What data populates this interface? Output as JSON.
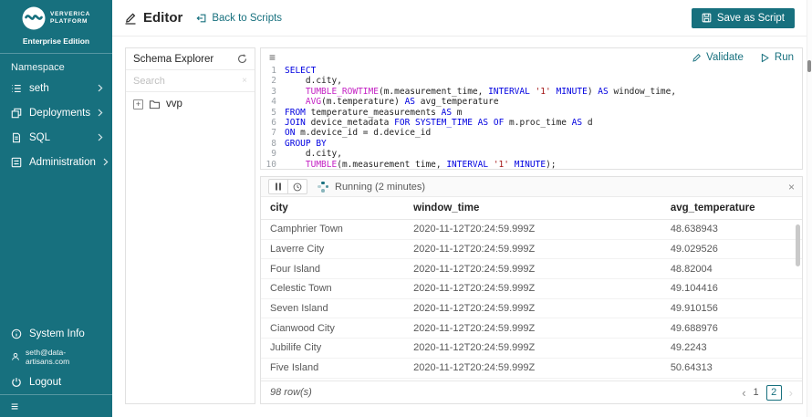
{
  "colors": {
    "accent": "#17707e",
    "sql_keyword": "#0000e0",
    "sql_function": "#c31fc3",
    "sql_string": "#a31515",
    "sql_plain": "#1f1f1f"
  },
  "sidebar": {
    "brand_line1": "VERVERICA",
    "brand_line2": "PLATFORM",
    "edition": "Enterprise Edition",
    "namespace_label": "Namespace",
    "namespace_item": "seth",
    "nav_items": [
      {
        "label": "Deployments",
        "icon": "deployments-icon"
      },
      {
        "label": "SQL",
        "icon": "sql-document-icon"
      },
      {
        "label": "Administration",
        "icon": "administration-icon"
      }
    ],
    "system_info_label": "System Info",
    "user_email": "seth@data-artisans.com",
    "logout_label": "Logout"
  },
  "header": {
    "page_title": "Editor",
    "back_link_label": "Back to Scripts",
    "save_button_label": "Save as Script"
  },
  "schema_explorer": {
    "title": "Schema Explorer",
    "search_placeholder": "Search",
    "tree_items": [
      {
        "label": "vvp",
        "icon": "folder-icon",
        "expandable": true
      }
    ]
  },
  "editor": {
    "validate_label": "Validate",
    "run_label": "Run",
    "code_lines": [
      {
        "num": "1",
        "segments": [
          [
            "SELECT",
            "k"
          ]
        ]
      },
      {
        "num": "2",
        "segments": [
          [
            "    d.city,",
            "p"
          ]
        ]
      },
      {
        "num": "3",
        "segments": [
          [
            "    ",
            "p"
          ],
          [
            "TUMBLE_ROWTIME",
            "f"
          ],
          [
            "(m.measurement_time, ",
            "p"
          ],
          [
            "INTERVAL",
            "k"
          ],
          [
            " ",
            "p"
          ],
          [
            "'1'",
            "s"
          ],
          [
            " ",
            "p"
          ],
          [
            "MINUTE",
            "k"
          ],
          [
            ") ",
            "p"
          ],
          [
            "AS",
            "k"
          ],
          [
            " window_time,",
            "p"
          ]
        ]
      },
      {
        "num": "4",
        "segments": [
          [
            "    ",
            "p"
          ],
          [
            "AVG",
            "f"
          ],
          [
            "(m.temperature) ",
            "p"
          ],
          [
            "AS",
            "k"
          ],
          [
            " avg_temperature",
            "p"
          ]
        ]
      },
      {
        "num": "5",
        "segments": [
          [
            "FROM",
            "k"
          ],
          [
            " temperature_measurements ",
            "p"
          ],
          [
            "AS",
            "k"
          ],
          [
            " m",
            "p"
          ]
        ]
      },
      {
        "num": "6",
        "segments": [
          [
            "JOIN",
            "k"
          ],
          [
            " device_metadata ",
            "p"
          ],
          [
            "FOR SYSTEM_TIME",
            "k"
          ],
          [
            " ",
            "p"
          ],
          [
            "AS",
            "k"
          ],
          [
            " ",
            "p"
          ],
          [
            "OF",
            "k"
          ],
          [
            " m.proc_time ",
            "p"
          ],
          [
            "AS",
            "k"
          ],
          [
            " d",
            "p"
          ]
        ]
      },
      {
        "num": "7",
        "segments": [
          [
            "ON",
            "k"
          ],
          [
            " m.device_id = d.device_id",
            "p"
          ]
        ]
      },
      {
        "num": "8",
        "segments": [
          [
            "GROUP BY",
            "k"
          ]
        ]
      },
      {
        "num": "9",
        "segments": [
          [
            "    d.city,",
            "p"
          ]
        ]
      },
      {
        "num": "10",
        "segments": [
          [
            "    ",
            "p"
          ],
          [
            "TUMBLE",
            "f"
          ],
          [
            "(m.measurement_time, ",
            "p"
          ],
          [
            "INTERVAL",
            "k"
          ],
          [
            " ",
            "p"
          ],
          [
            "'1'",
            "s"
          ],
          [
            " ",
            "p"
          ],
          [
            "MINUTE",
            "k"
          ],
          [
            ");",
            "p"
          ]
        ]
      }
    ]
  },
  "results": {
    "status_text": "Running (2 minutes)",
    "columns": [
      "city",
      "window_time",
      "avg_temperature"
    ],
    "rows": [
      [
        "Camphrier Town",
        "2020-11-12T20:24:59.999Z",
        "48.638943"
      ],
      [
        "Laverre City",
        "2020-11-12T20:24:59.999Z",
        "49.029526"
      ],
      [
        "Four Island",
        "2020-11-12T20:24:59.999Z",
        "48.82004"
      ],
      [
        "Celestic Town",
        "2020-11-12T20:24:59.999Z",
        "49.104416"
      ],
      [
        "Seven Island",
        "2020-11-12T20:24:59.999Z",
        "49.910156"
      ],
      [
        "Cianwood City",
        "2020-11-12T20:24:59.999Z",
        "49.688976"
      ],
      [
        "Jubilife City",
        "2020-11-12T20:24:59.999Z",
        "49.2243"
      ],
      [
        "Five Island",
        "2020-11-12T20:24:59.999Z",
        "50.64313"
      ]
    ],
    "row_count_text": "98 row(s)",
    "pagination": {
      "prev": "‹",
      "pages": [
        "1",
        "2"
      ],
      "current_page": "2",
      "next": "›"
    }
  },
  "icons_text": {
    "close": "×",
    "clear": "×",
    "menu": "≡",
    "collapse": "≡",
    "expand_plus": "+"
  }
}
